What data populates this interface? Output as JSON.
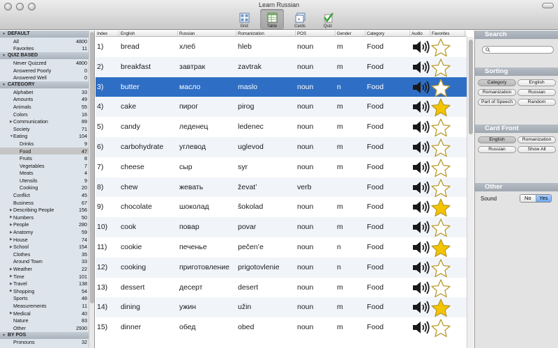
{
  "window": {
    "title": "Learn Russian"
  },
  "toolbar": [
    {
      "label": "Grid",
      "icon": "grid-icon",
      "active": false
    },
    {
      "label": "Table",
      "icon": "table-icon",
      "active": true
    },
    {
      "label": "Cards",
      "icon": "cards-icon",
      "active": false
    },
    {
      "label": "Quiz",
      "icon": "quiz-checkmark-icon",
      "active": false
    }
  ],
  "sidebar": {
    "sections": [
      {
        "title": "DEFAULT",
        "items": [
          {
            "label": "All",
            "count": "4800",
            "indent": 1
          },
          {
            "label": "Favorites",
            "count": "11",
            "indent": 1
          }
        ]
      },
      {
        "title": "QUIZ BASED",
        "items": [
          {
            "label": "Never Quizzed",
            "count": "4800",
            "indent": 1
          },
          {
            "label": "Answered Poorly",
            "count": "0",
            "indent": 1
          },
          {
            "label": "Answered Well",
            "count": "0",
            "indent": 1
          }
        ]
      },
      {
        "title": "CATEGORY",
        "items": [
          {
            "label": "Alphabet",
            "count": "33",
            "indent": 1
          },
          {
            "label": "Amounts",
            "count": "49",
            "indent": 1
          },
          {
            "label": "Animals",
            "count": "55",
            "indent": 1
          },
          {
            "label": "Colors",
            "count": "16",
            "indent": 1
          },
          {
            "label": "Communication",
            "count": "89",
            "indent": 1,
            "disclosure": "collapsed"
          },
          {
            "label": "Society",
            "count": "71",
            "indent": 1
          },
          {
            "label": "Eating",
            "count": "104",
            "indent": 1,
            "disclosure": "expanded"
          },
          {
            "label": "Drinks",
            "count": "9",
            "indent": 2
          },
          {
            "label": "Food",
            "count": "47",
            "indent": 2,
            "selected": true
          },
          {
            "label": "Fruits",
            "count": "8",
            "indent": 2
          },
          {
            "label": "Vegetables",
            "count": "7",
            "indent": 2
          },
          {
            "label": "Meats",
            "count": "4",
            "indent": 2
          },
          {
            "label": "Utensils",
            "count": "9",
            "indent": 2
          },
          {
            "label": "Cooking",
            "count": "20",
            "indent": 2
          },
          {
            "label": "Conflict",
            "count": "45",
            "indent": 1
          },
          {
            "label": "Business",
            "count": "67",
            "indent": 1
          },
          {
            "label": "Describing People",
            "count": "156",
            "indent": 1,
            "disclosure": "collapsed"
          },
          {
            "label": "Numbers",
            "count": "50",
            "indent": 1,
            "disclosure": "collapsed"
          },
          {
            "label": "People",
            "count": "280",
            "indent": 1,
            "disclosure": "collapsed"
          },
          {
            "label": "Anatomy",
            "count": "59",
            "indent": 1,
            "disclosure": "collapsed"
          },
          {
            "label": "House",
            "count": "74",
            "indent": 1,
            "disclosure": "collapsed"
          },
          {
            "label": "School",
            "count": "154",
            "indent": 1,
            "disclosure": "collapsed"
          },
          {
            "label": "Clothes",
            "count": "35",
            "indent": 1
          },
          {
            "label": "Around Town",
            "count": "33",
            "indent": 1
          },
          {
            "label": "Weather",
            "count": "22",
            "indent": 1,
            "disclosure": "collapsed"
          },
          {
            "label": "Time",
            "count": "101",
            "indent": 1,
            "disclosure": "collapsed"
          },
          {
            "label": "Travel",
            "count": "138",
            "indent": 1,
            "disclosure": "collapsed"
          },
          {
            "label": "Shopping",
            "count": "54",
            "indent": 1,
            "disclosure": "collapsed"
          },
          {
            "label": "Sports",
            "count": "48",
            "indent": 1
          },
          {
            "label": "Measurements",
            "count": "11",
            "indent": 1
          },
          {
            "label": "Medical",
            "count": "40",
            "indent": 1,
            "disclosure": "collapsed"
          },
          {
            "label": "Nature",
            "count": "83",
            "indent": 1
          },
          {
            "label": "Other",
            "count": "2930",
            "indent": 1
          }
        ]
      },
      {
        "title": "BY POS",
        "items": [
          {
            "label": "Pronouns",
            "count": "32",
            "indent": 1
          }
        ]
      }
    ]
  },
  "table": {
    "columns": [
      "Index",
      "English",
      "Russian",
      "Romanization",
      "POS",
      "Gender",
      "Category",
      "Audio",
      "Favorites"
    ],
    "rows": [
      {
        "index": "1)",
        "english": "bread",
        "russian": "хлеб",
        "roman": "hleb",
        "pos": "noun",
        "gender": "m",
        "category": "Food",
        "favorite": false
      },
      {
        "index": "2)",
        "english": "breakfast",
        "russian": "завтрак",
        "roman": "zavtrak",
        "pos": "noun",
        "gender": "m",
        "category": "Food",
        "favorite": false
      },
      {
        "index": "3)",
        "english": "butter",
        "russian": "масло",
        "roman": "maslo",
        "pos": "noun",
        "gender": "n",
        "category": "Food",
        "favorite": false,
        "selected": true
      },
      {
        "index": "4)",
        "english": "cake",
        "russian": "пирог",
        "roman": "pirog",
        "pos": "noun",
        "gender": "m",
        "category": "Food",
        "favorite": true
      },
      {
        "index": "5)",
        "english": "candy",
        "russian": "леденец",
        "roman": "ledenec",
        "pos": "noun",
        "gender": "m",
        "category": "Food",
        "favorite": false
      },
      {
        "index": "6)",
        "english": "carbohydrate",
        "russian": "углевод",
        "roman": "uglevod",
        "pos": "noun",
        "gender": "m",
        "category": "Food",
        "favorite": false
      },
      {
        "index": "7)",
        "english": "cheese",
        "russian": "сыр",
        "roman": "syr",
        "pos": "noun",
        "gender": "m",
        "category": "Food",
        "favorite": false
      },
      {
        "index": "8)",
        "english": "chew",
        "russian": "жевать",
        "roman": "ževat’",
        "pos": "verb",
        "gender": "",
        "category": "Food",
        "favorite": false
      },
      {
        "index": "9)",
        "english": "chocolate",
        "russian": "шоколад",
        "roman": "šokolad",
        "pos": "noun",
        "gender": "m",
        "category": "Food",
        "favorite": true
      },
      {
        "index": "10)",
        "english": "cook",
        "russian": "повар",
        "roman": "povar",
        "pos": "noun",
        "gender": "m",
        "category": "Food",
        "favorite": false
      },
      {
        "index": "11)",
        "english": "cookie",
        "russian": "печенье",
        "roman": "pečen’e",
        "pos": "noun",
        "gender": "n",
        "category": "Food",
        "favorite": true
      },
      {
        "index": "12)",
        "english": "cooking",
        "russian": "приготовление",
        "roman": "prigotovlenie",
        "pos": "noun",
        "gender": "n",
        "category": "Food",
        "favorite": false
      },
      {
        "index": "13)",
        "english": "dessert",
        "russian": "десерт",
        "roman": "desert",
        "pos": "noun",
        "gender": "m",
        "category": "Food",
        "favorite": false
      },
      {
        "index": "14)",
        "english": "dining",
        "russian": "ужин",
        "roman": "užin",
        "pos": "noun",
        "gender": "m",
        "category": "Food",
        "favorite": true
      },
      {
        "index": "15)",
        "english": "dinner",
        "russian": "обед",
        "roman": "obed",
        "pos": "noun",
        "gender": "m",
        "category": "Food",
        "favorite": false
      }
    ]
  },
  "right_panel": {
    "search": {
      "title": "Search",
      "placeholder": ""
    },
    "sorting": {
      "title": "Sorting",
      "buttons": [
        "Category",
        "English",
        "Romanization",
        "Russian",
        "Part of Speech",
        "Random"
      ],
      "active": "Category"
    },
    "card_front": {
      "title": "Card Front",
      "buttons": [
        "English",
        "Romanization",
        "Russian",
        "Show All"
      ],
      "active": "English"
    },
    "other": {
      "title": "Other",
      "sound_label": "Sound",
      "no": "No",
      "yes": "Yes",
      "selected": "Yes"
    }
  },
  "colors": {
    "selection": "#2f6ec5",
    "star_on": "#f5c400",
    "sidebar_bg": "#dde4ec"
  }
}
